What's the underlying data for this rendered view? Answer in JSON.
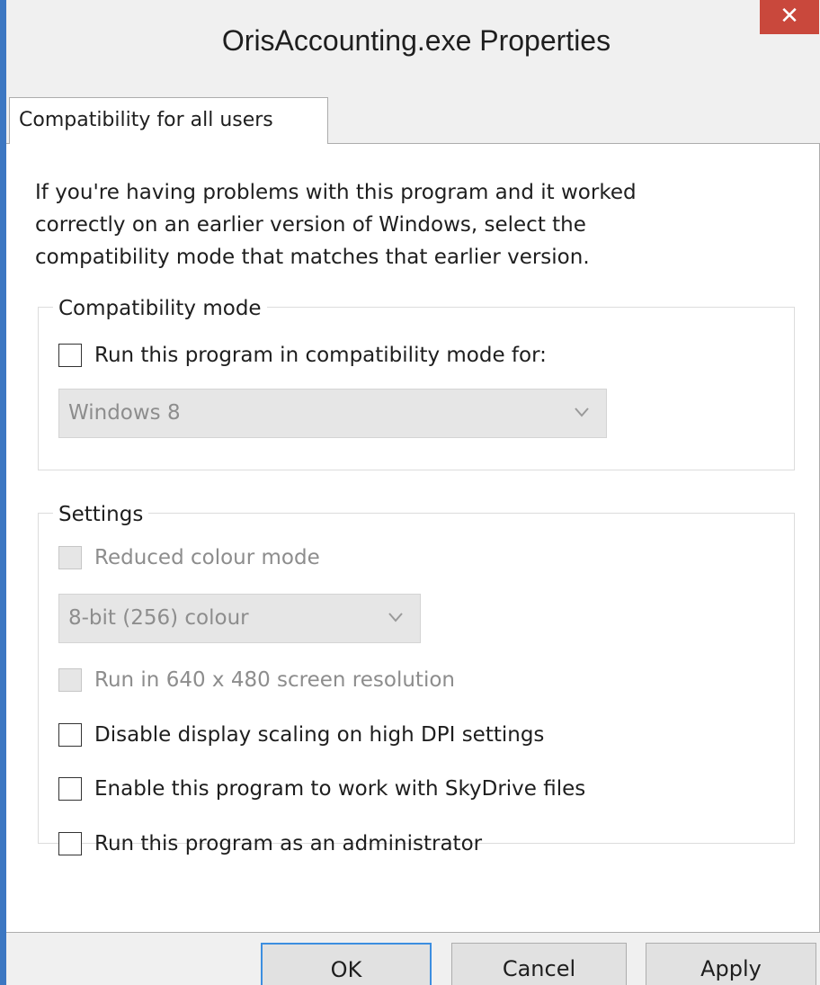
{
  "window": {
    "title": "OrisAccounting.exe Properties",
    "close_glyph": "✕"
  },
  "tab": {
    "label": "Compatibility for all users"
  },
  "intro": {
    "line1": "If you're having problems with this program and it worked",
    "line2": "correctly on an earlier version of Windows, select the",
    "line3": "compatibility mode that matches that earlier version."
  },
  "compat_mode": {
    "legend": "Compatibility mode",
    "checkbox_label": "Run this program in compatibility mode for:",
    "checked": false,
    "os_select_value": "Windows 8",
    "os_select_enabled": false
  },
  "settings": {
    "legend": "Settings",
    "reduced_colour": {
      "label": "Reduced colour mode",
      "checked": false,
      "enabled": false
    },
    "colour_select_value": "8-bit (256) colour",
    "resolution_640": {
      "label": "Run in 640 x 480 screen resolution",
      "checked": false,
      "enabled": false
    },
    "disable_dpi": {
      "label": "Disable display scaling on high DPI settings",
      "checked": false
    },
    "skydrive": {
      "label": "Enable this program to work with SkyDrive files",
      "checked": false
    },
    "admin": {
      "label": "Run this program as an administrator",
      "checked": false
    }
  },
  "buttons": {
    "ok": "OK",
    "cancel": "Cancel",
    "apply": "Apply"
  },
  "colors": {
    "window_border": "#3c77c2",
    "close_button": "#c9483c",
    "default_button_border": "#3c8ee0"
  }
}
